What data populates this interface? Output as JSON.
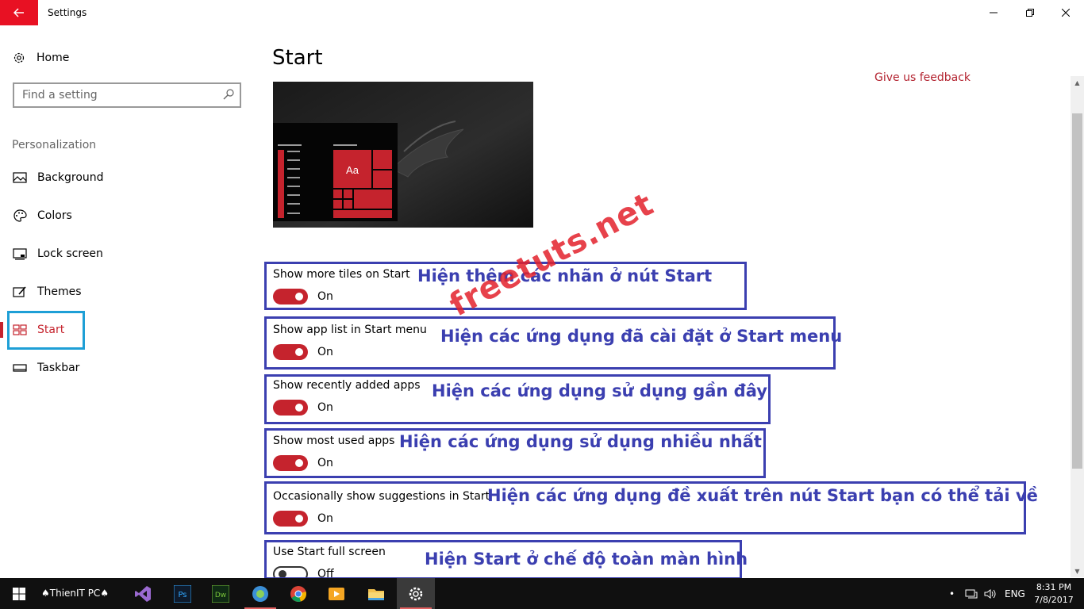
{
  "window": {
    "title": "Settings"
  },
  "sidebar": {
    "home_label": "Home",
    "search_placeholder": "Find a setting",
    "section": "Personalization",
    "items": [
      {
        "label": "Background",
        "icon": "picture-icon"
      },
      {
        "label": "Colors",
        "icon": "palette-icon"
      },
      {
        "label": "Lock screen",
        "icon": "lock-screen-icon"
      },
      {
        "label": "Themes",
        "icon": "themes-icon"
      },
      {
        "label": "Start",
        "icon": "start-icon",
        "active": true
      },
      {
        "label": "Taskbar",
        "icon": "taskbar-icon"
      }
    ]
  },
  "main": {
    "title": "Start",
    "feedback": "Give us feedback",
    "preview_tile_label": "Aa",
    "settings": [
      {
        "label": "Show more tiles on Start",
        "state": "On",
        "on": true
      },
      {
        "label": "Show app list in Start menu",
        "state": "On",
        "on": true
      },
      {
        "label": "Show recently added apps",
        "state": "On",
        "on": true
      },
      {
        "label": "Show most used apps",
        "state": "On",
        "on": true
      },
      {
        "label": "Occasionally show suggestions in Start",
        "state": "On",
        "on": true
      },
      {
        "label": "Use Start full screen",
        "state": "Off",
        "on": false
      }
    ]
  },
  "annotations": [
    "Hiện thêm các nhãn ở nút Start",
    "Hiện các ứng dụng đã cài đặt ở Start menu",
    "Hiện các ứng dụng sử dụng gần đây",
    "Hiện các ứng dụng sử dụng nhiều nhất",
    "Hiện các ứng dụng đề xuất trên nút Start bạn có thể tải về",
    "Hiện Start ở chế độ toàn màn hình"
  ],
  "watermark": "freetuts.net",
  "taskbar": {
    "user": "♠ThienIT PC♠",
    "language": "ENG",
    "time": "8:31 PM",
    "date": "7/8/2017"
  },
  "colors": {
    "accent": "#c5232d",
    "annotation": "#3b3fb0",
    "highlight": "#1e9fd6",
    "back_button": "#e81123"
  }
}
